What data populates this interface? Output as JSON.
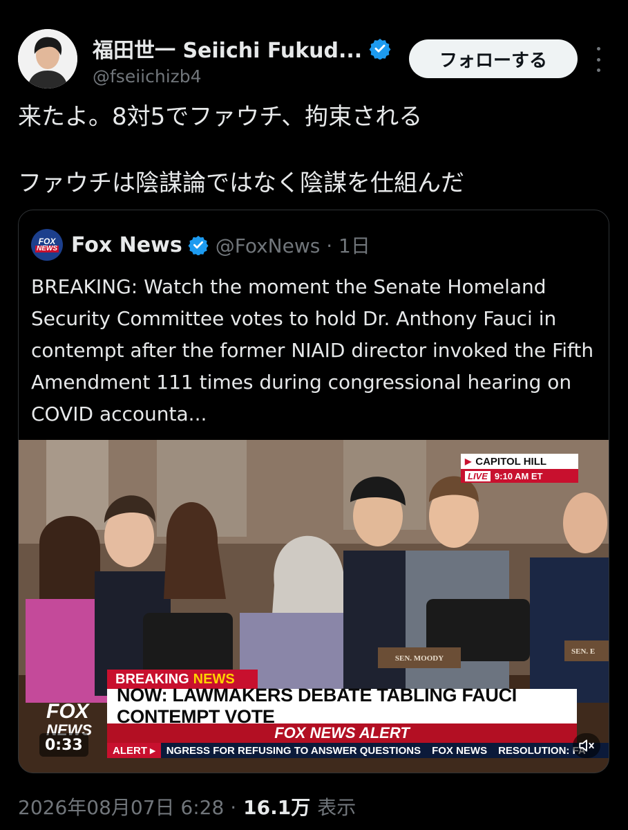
{
  "author": {
    "display_name": "福田世一 Seiichi Fukud...",
    "handle": "@fseiichizb4",
    "follow_label": "フォローする"
  },
  "tweet": {
    "line1": "来たよ。8対5でファウチ、拘束される",
    "line2": "ファウチは陰謀論ではなく陰謀を仕組んだ"
  },
  "quote": {
    "display_name": "Fox News",
    "handle_time": "@FoxNews · 1日",
    "logo_line1": "FOX",
    "logo_line2": "NEWS",
    "text": "BREAKING: Watch the moment the Senate Homeland Security Committee votes to hold Dr. Anthony Fauci in contempt after the former NIAID director invoked the Fifth Amendment 111 times during congressional hearing on COVID accounta..."
  },
  "video": {
    "capitol_title": "CAPITOL HILL",
    "live_label": "LIVE",
    "live_time": "9:10 AM ET",
    "breaking_label": "BREAKING",
    "breaking_news": "NEWS",
    "headline": "NOW: LAWMAKERS DEBATE TABLING FAUCI CONTEMPT VOTE",
    "alert_title": "FOX NEWS ALERT",
    "ticker_alert": "ALERT ▸",
    "ticker_text": "NGRESS FOR REFUSING TO ANSWER QUESTIONS",
    "ticker_brand": "FOX NEWS",
    "ticker_resolution": "RESOLUTION: FA",
    "bug_line1": "FOX",
    "bug_line2": "NEWS",
    "nameplate_left": "SEN. MOODY",
    "nameplate_right": "SEN. E",
    "timecode": "0:33"
  },
  "footer": {
    "datetime": "2026年08月07日 6:28 ·",
    "views": "16.1万",
    "views_label": "表示"
  },
  "colors": {
    "background": "#000000",
    "text": "#e7e9ea",
    "muted": "#71767b",
    "verified_blue": "#1d9bf0",
    "fox_red": "#c8102e"
  }
}
